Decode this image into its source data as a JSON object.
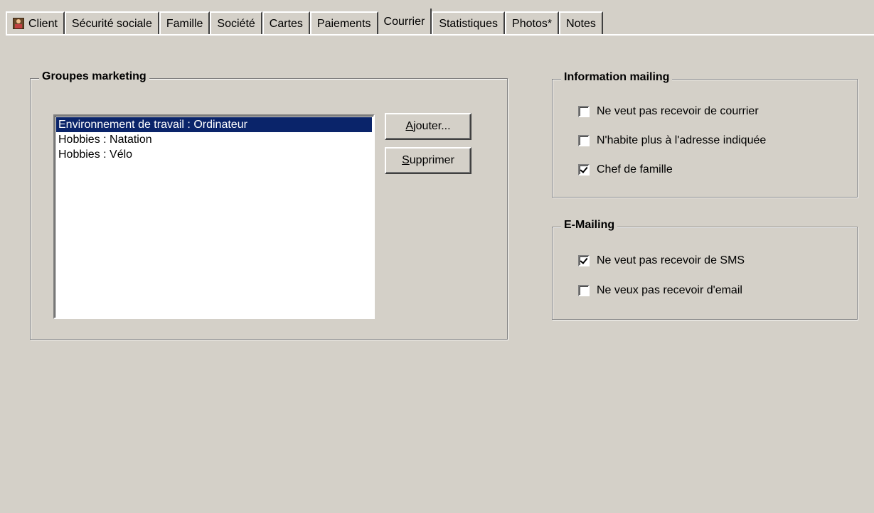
{
  "tabs": [
    {
      "label": "Client",
      "icon": "client-icon",
      "active": false
    },
    {
      "label": "Sécurité sociale",
      "active": false
    },
    {
      "label": "Famille",
      "active": false
    },
    {
      "label": "Société",
      "active": false
    },
    {
      "label": "Cartes",
      "active": false
    },
    {
      "label": "Paiements",
      "active": false
    },
    {
      "label": "Courrier",
      "active": true
    },
    {
      "label": "Statistiques",
      "active": false
    },
    {
      "label": "Photos*",
      "active": false
    },
    {
      "label": "Notes",
      "active": false
    }
  ],
  "marketing": {
    "title": "Groupes marketing",
    "items": [
      {
        "label": "Environnement de travail : Ordinateur",
        "selected": true
      },
      {
        "label": "Hobbies : Natation",
        "selected": false
      },
      {
        "label": "Hobbies : Vélo",
        "selected": false
      }
    ],
    "add_label_mnemonic": "A",
    "add_label_rest": "jouter...",
    "remove_label_mnemonic": "S",
    "remove_label_rest": "upprimer"
  },
  "mailing": {
    "title": "Information mailing",
    "options": [
      {
        "label": "Ne veut pas recevoir de courrier",
        "checked": false
      },
      {
        "label": "N'habite plus à l'adresse indiquée",
        "checked": false
      },
      {
        "label": "Chef de famille",
        "checked": true
      }
    ]
  },
  "emailing": {
    "title": "E-Mailing",
    "options": [
      {
        "label": "Ne veut pas recevoir de SMS",
        "checked": true
      },
      {
        "label": "Ne veux pas recevoir d'email",
        "checked": false
      }
    ]
  },
  "colors": {
    "face": "#d4d0c8",
    "selection": "#0a246a",
    "selection_text": "#ffffff"
  }
}
